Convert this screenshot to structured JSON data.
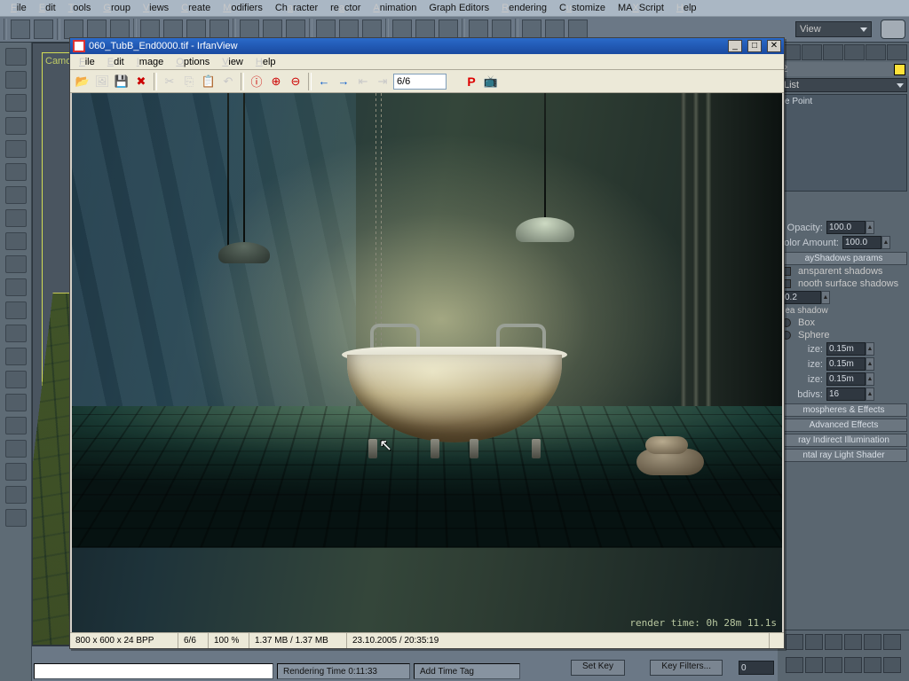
{
  "host": {
    "menu": [
      "File",
      "Edit",
      "Tools",
      "Group",
      "Views",
      "Create",
      "Modifiers",
      "Character",
      "reactor",
      "Animation",
      "Graph Editors",
      "Rendering",
      "Customize",
      "MAXScript",
      "Help"
    ],
    "view_dropdown": "View",
    "viewport_label": "Camo"
  },
  "right": {
    "sel_color_label": "",
    "modlist": "List",
    "modifier": "e Point",
    "gp_opacity_label": "Opacity:",
    "gp_opacity": "100.0",
    "gp_color_label": "olor Amount:",
    "gp_color": "100.0",
    "roll_shadows": "ayShadows params",
    "chk_transparent": "ansparent shadows",
    "chk_smooth": "nooth surface shadows",
    "smooth_val": "0.2",
    "lbl_area": "rea shadow",
    "lbl_box": "Box",
    "lbl_sphere": "Sphere",
    "size_label": "ize:",
    "size1": "0.15m",
    "size2": "0.15m",
    "size3": "0.15m",
    "subdiv_label": "bdivs:",
    "subdiv": "16",
    "roll_atmo": "mospheres & Effects",
    "roll_adv": "Advanced Effects",
    "roll_indir": "ray Indirect Illumination",
    "roll_light": "ntal ray Light Shader"
  },
  "status": {
    "rendering_time": "Rendering Time  0:11:33",
    "add_time_tag": "Add Time Tag",
    "setkey": "Set Key",
    "keyfilters": "Key Filters...",
    "frame": "0"
  },
  "iv": {
    "title": "060_TubB_End0000.tif - IrfanView",
    "menu": [
      "File",
      "Edit",
      "Image",
      "Options",
      "View",
      "Help"
    ],
    "page_field": "6/6",
    "render_time_overlay": "render time: 0h 28m 11.1s",
    "status": {
      "dims": "800 x 600 x 24 BPP",
      "page": "6/6",
      "zoom": "100 %",
      "mem": "1.37 MB / 1.37 MB",
      "date": "23.10.2005 / 20:35:19"
    },
    "icons": {
      "open": "📂",
      "slide": "🖼",
      "save": "💾",
      "delete": "✖",
      "cut": "✂",
      "copy": "⎘",
      "paste": "📋",
      "undo": "↶",
      "info": "ⓘ",
      "zoomin": "⊕",
      "zoomout": "⊖",
      "prev": "←",
      "next": "→",
      "first": "⇤",
      "last": "⇥",
      "paint": "P",
      "tv": "📺"
    }
  }
}
